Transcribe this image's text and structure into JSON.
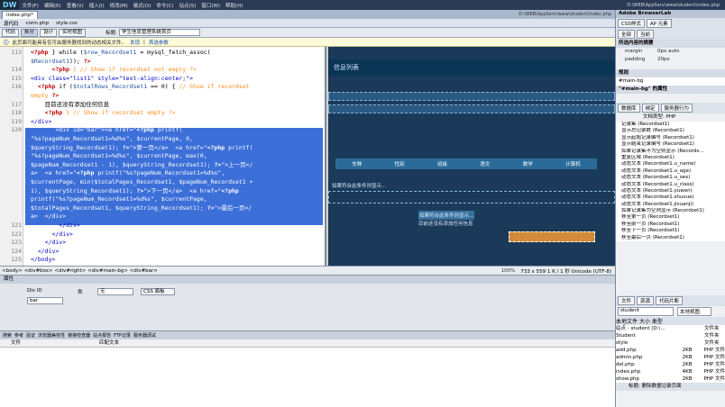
{
  "app": {
    "logo": "DW",
    "menu": [
      "文件(F)",
      "编辑(E)",
      "查看(V)",
      "插入(I)",
      "修改(M)",
      "格式(O)",
      "命令(C)",
      "站点(S)",
      "窗口(W)",
      "帮助(H)"
    ],
    "window_path": "D:\\WEB\\AppServ\\www\\student\\index.php"
  },
  "doc_tab": "index.php*",
  "doc_path": "D:\\WEB\\AppServ\\www\\student\\index.php",
  "related_files": [
    "源代码",
    "conn.php",
    "style.css"
  ],
  "toolbar": {
    "buttons": [
      "代码",
      "拆分",
      "设计",
      "实时视图"
    ],
    "title_label": "标题:",
    "title_value": "学生信息管理系统首页"
  },
  "infobar": {
    "message": "此页面可能具有仅可由服务器找到的动态相关文件。",
    "discover": "发现",
    "prefs": "首选参数"
  },
  "code": {
    "lines": [
      {
        "n": "113",
        "html": "<span class=\"php\">&lt;?php</span> } while (<span class=\"var\">$row_Recordset1</span> = mysql_fetch_assoc("
      },
      {
        "n": "",
        "html": "<span class=\"var\">$Recordset1</span>)); <span class=\"php\">?&gt;</span>"
      },
      {
        "n": "114",
        "html": "      <span class=\"php\">&lt;?php</span> <span class=\"cmt\">} // Show if recordset not empty ?&gt;</span>"
      },
      {
        "n": "115",
        "html": "<span class=\"tag\">&lt;div class=\"list1\" style=\"text-align:center;\"&gt;</span>"
      },
      {
        "n": "116",
        "html": "  <span class=\"php\">&lt;?php</span> if (<span class=\"var\">$totalRows_Recordset1</span> == 0) { <span class=\"cmt\">// Show if recordset</span>"
      },
      {
        "n": "",
        "html": "<span class=\"cmt\">empty</span> <span class=\"php\">?&gt;</span>"
      },
      {
        "n": "117",
        "html": "    目前还没有添加任何信息"
      },
      {
        "n": "118",
        "html": "    <span class=\"php\">&lt;?php</span> <span class=\"cmt\">} // Show if recordset empty ?&gt;</span>"
      },
      {
        "n": "119",
        "html": "<span class=\"tag\">&lt;/div&gt;</span>"
      },
      {
        "n": "120",
        "html": "       &lt;div id=\"bar\"&gt;&lt;a href=\"<b>&lt;?php</b> printf(",
        "sel": true
      },
      {
        "n": "",
        "html": "\"%s?pageNum_Recordset1=%d%s\", $currentPage, 0,",
        "sel": true
      },
      {
        "n": "",
        "html": "$queryString_Recordset1); <b>?&gt;</b>\"&gt;第一页&lt;/a&gt;  &lt;a href=\"<b>&lt;?php</b> printf(",
        "sel": true
      },
      {
        "n": "",
        "html": "\"%s?pageNum_Recordset1=%d%s\", $currentPage, max(0,",
        "sel": true
      },
      {
        "n": "",
        "html": "$pageNum_Recordset1 - 1), $queryString_Recordset1); <b>?&gt;</b>\"&gt;上一页&lt;/",
        "sel": true
      },
      {
        "n": "",
        "html": "a&gt;  &lt;a href=\"<b>&lt;?php</b> printf(\"%s?pageNum_Recordset1=%d%s\",",
        "sel": true
      },
      {
        "n": "",
        "html": "$currentPage, min($totalPages_Recordset1, $pageNum_Recordset1 +",
        "sel": true
      },
      {
        "n": "",
        "html": "1), $queryString_Recordset1); <b>?&gt;</b>\"&gt;下一页&lt;/a&gt;  &lt;a href=\"<b>&lt;?php</b>",
        "sel": true
      },
      {
        "n": "",
        "html": "printf(\"%s?pageNum_Recordset1=%d%s\", $currentPage,",
        "sel": true
      },
      {
        "n": "",
        "html": "$totalPages_Recordset1, $queryString_Recordset1); <b>?&gt;</b>\"&gt;最后一页&lt;/",
        "sel": true
      },
      {
        "n": "",
        "html": "a&gt;  &lt;/div&gt;",
        "sel": true
      },
      {
        "n": "121",
        "html": "        <span class=\"tag\">&lt;/div&gt;</span>"
      },
      {
        "n": "122",
        "html": "      <span class=\"tag\">&lt;/div&gt;</span>"
      },
      {
        "n": "123",
        "html": "    <span class=\"tag\">&lt;/div&gt;</span>"
      },
      {
        "n": "124",
        "html": "  <span class=\"tag\">&lt;/div&gt;</span>"
      },
      {
        "n": "125",
        "html": "<span class=\"tag\">&lt;/body&gt;</span>"
      }
    ]
  },
  "design": {
    "banner": "信息列表",
    "header_cols": [
      "车种",
      "性别",
      "班级",
      "语文",
      "数学",
      "计算机"
    ],
    "empty_msg1": "如果符合此条件则显示...",
    "empty_msg2": "如果符合此条件则显示...",
    "empty_msg3": "目前还没有添加任何信息"
  },
  "statusbar": {
    "breadcrumb": "<body> <div#box> <div#right> <div#main-bg> <div#bar>",
    "zoom": "100%",
    "info": "733 x 559 1 K / 1 秒 Unicode (UTF-8)"
  },
  "props": {
    "title": "属性",
    "div_id_label": "Div ID",
    "div_id_value": "bar",
    "class_label": "类",
    "class_value": "无",
    "css_btn": "CSS 面板"
  },
  "results": {
    "tabs": [
      "搜索",
      "参考",
      "验证",
      "浏览器兼容性",
      "链接检查器",
      "站点报告",
      "FTP记录",
      "服务器调试"
    ],
    "cols": [
      "文件",
      "匹配文本"
    ]
  },
  "right": {
    "browserlab": "Adobe BrowserLab",
    "css_tabs": [
      "CSS样式",
      "AP 元素"
    ],
    "css_subtabs": [
      "全部",
      "当前"
    ],
    "summary_title": "所选内容的摘要",
    "props": [
      {
        "k": "margin",
        "v": "0px auto"
      },
      {
        "k": "padding",
        "v": "20px"
      }
    ],
    "rules_title": "规则",
    "rule_name": "#main-bg",
    "props_title": "\"#main-bg\" 的属性",
    "panel_tabs": [
      "数据库",
      "绑定",
      "服务器行为"
    ],
    "doc_type": "文档类型: PHP",
    "behaviors": [
      "记录集 (Recordset1)",
      "显示总记录数 (Recordset1)",
      "显示起始记录编号 (Recordset1)",
      "显示结束记录编号 (Recordset1)",
      "如果记录集不为空则显示 (Records...",
      "重复区域 (Recordset1)",
      "动态文本 (Recordset1.u_name)",
      "动态文本 (Recordset1.u_age)",
      "动态文本 (Recordset1.u_sex)",
      "动态文本 (Recordset1.u_class)",
      "动态文本 (Recordset1.yuwen)",
      "动态文本 (Recordset1.shuxue)",
      "动态文本 (Recordset1.jisuanji)",
      "如果记录集为空则显示 (Recordset1)",
      "移至第一页 (Recordset1)",
      "移至前一页 (Recordset1)",
      "移至下一页 (Recordset1)",
      "移至最后一页 (Recordset1)"
    ],
    "files_tabs": [
      "文件",
      "资源",
      "代码片断"
    ],
    "site": "student",
    "view": "本地视图",
    "tree_cols": [
      "本地文件",
      "大小",
      "类型"
    ],
    "tree": [
      {
        "n": "站点 - student (D:\\...",
        "s": "",
        "t": "文件夹"
      },
      {
        "n": "  Student",
        "s": "",
        "t": "文件夹"
      },
      {
        "n": "  style",
        "s": "",
        "t": "文件夹"
      },
      {
        "n": "    add.php",
        "s": "2KB",
        "t": "PHP 文件"
      },
      {
        "n": "    admin.php",
        "s": "2KB",
        "t": "PHP 文件"
      },
      {
        "n": "    del.php",
        "s": "2KB",
        "t": "PHP 文件"
      },
      {
        "n": "    index.php",
        "s": "4KB",
        "t": "PHP 文件"
      },
      {
        "n": "    show.php",
        "s": "2KB",
        "t": "PHP 文件"
      }
    ],
    "footer": "标题: 删除数据记录页面"
  }
}
